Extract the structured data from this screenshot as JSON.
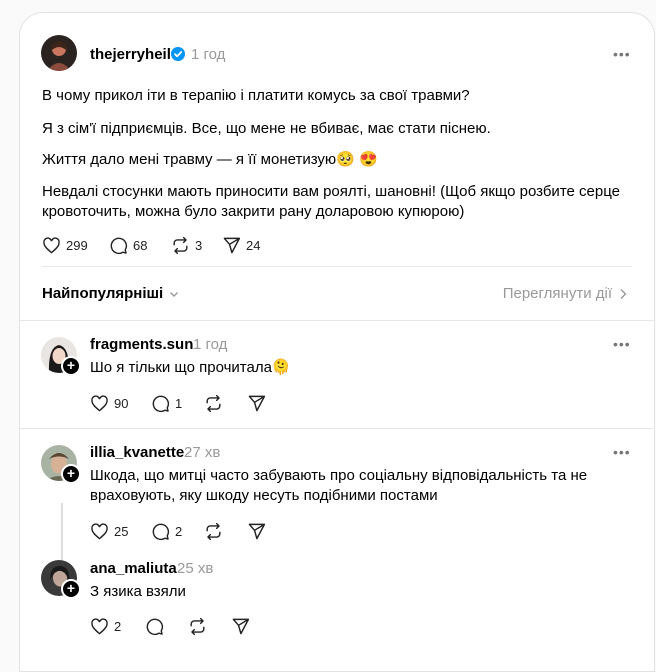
{
  "post": {
    "username": "thejerryheil",
    "time": "1 год",
    "paragraphs": [
      "В чому прикол іти в терапію і платити комусь за свої травми?",
      "Я з сім'ї підприємців. Все, що мене не вбиває, має стати піснею.",
      "Життя дало мені травму — я її монетизую🥺 😍",
      "Невдалі стосунки мають приносити вам роялті, шановні! (Щоб якщо розбите серце",
      "кровоточить, можна було закрити рану доларовою купюрою)"
    ],
    "likes": "299",
    "comments": "68",
    "reposts": "3",
    "shares": "24"
  },
  "sort_label": "Найпопулярніші",
  "view_activity": "Переглянути дії",
  "replies": [
    {
      "username": "fragments.sun",
      "time": "1 год",
      "text": "Шо я тільки що прочитала🫠",
      "likes": "90",
      "comments": "1"
    },
    {
      "username": "illia_kvanette",
      "time": "27 хв",
      "text_lines": [
        "Шкода, що митці часто забувають про соціальну відповідальність та не",
        "враховують, яку шкоду несуть подібними постами"
      ],
      "likes": "25",
      "comments": "2"
    },
    {
      "username": "ana_maliuta",
      "time": "25 хв",
      "text": "З язика взяли",
      "likes": "2"
    }
  ],
  "colors": {
    "verified": "#0095f6",
    "muted": "#999999"
  },
  "icons": [
    "heart-icon",
    "comment-icon",
    "repost-icon",
    "share-icon",
    "more-icon",
    "chevron-down-icon",
    "chevron-right-icon",
    "verified-icon",
    "follow-plus-icon"
  ]
}
